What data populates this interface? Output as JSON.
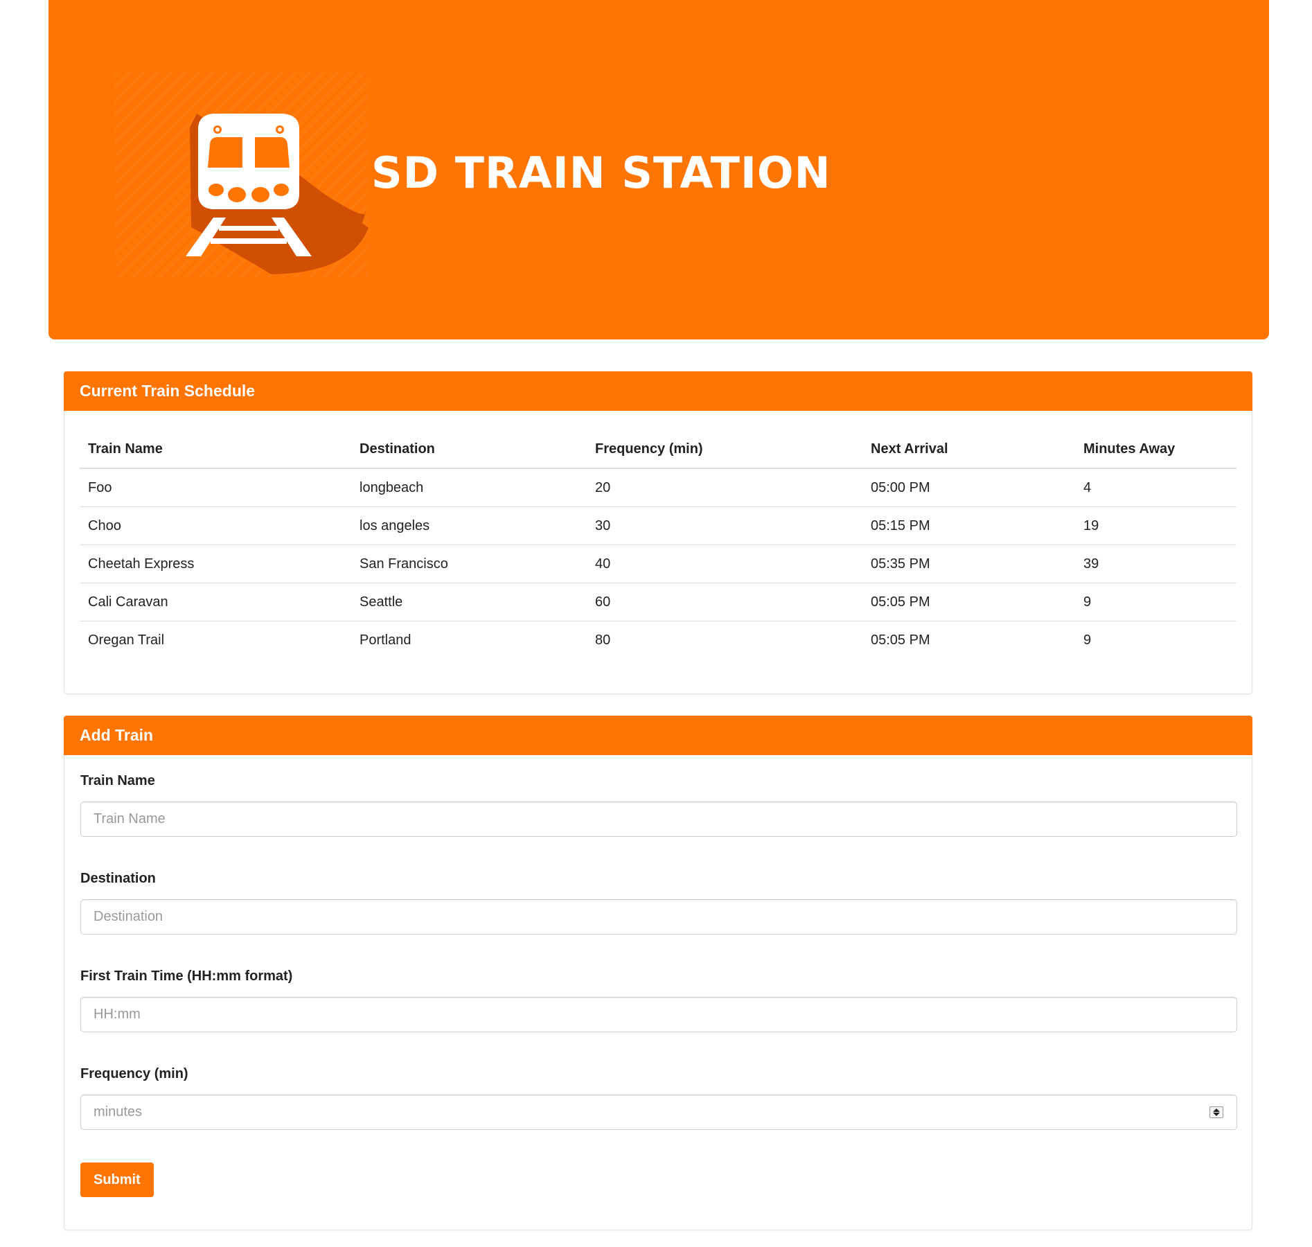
{
  "header": {
    "title": "SD TRAIN STATION",
    "brand_color": "#ff7504",
    "logo_icon": "train-icon"
  },
  "schedule": {
    "heading": "Current Train Schedule",
    "columns": [
      "Train Name",
      "Destination",
      "Frequency (min)",
      "Next Arrival",
      "Minutes Away"
    ],
    "rows": [
      [
        "Foo",
        "longbeach",
        "20",
        "05:00 PM",
        "4"
      ],
      [
        "Choo",
        "los angeles",
        "30",
        "05:15 PM",
        "19"
      ],
      [
        "Cheetah Express",
        "San Francisco",
        "40",
        "05:35 PM",
        "39"
      ],
      [
        "Cali Caravan",
        "Seattle",
        "60",
        "05:05 PM",
        "9"
      ],
      [
        "Oregan Trail",
        "Portland",
        "80",
        "05:05 PM",
        "9"
      ]
    ]
  },
  "add_train": {
    "heading": "Add Train",
    "fields": {
      "train_name": {
        "label": "Train Name",
        "placeholder": "Train Name",
        "value": ""
      },
      "destination": {
        "label": "Destination",
        "placeholder": "Destination",
        "value": ""
      },
      "first_time": {
        "label": "First Train Time (HH:mm format)",
        "placeholder": "HH:mm",
        "value": ""
      },
      "frequency": {
        "label": "Frequency (min)",
        "placeholder": "minutes",
        "value": ""
      }
    },
    "submit_label": "Submit"
  }
}
